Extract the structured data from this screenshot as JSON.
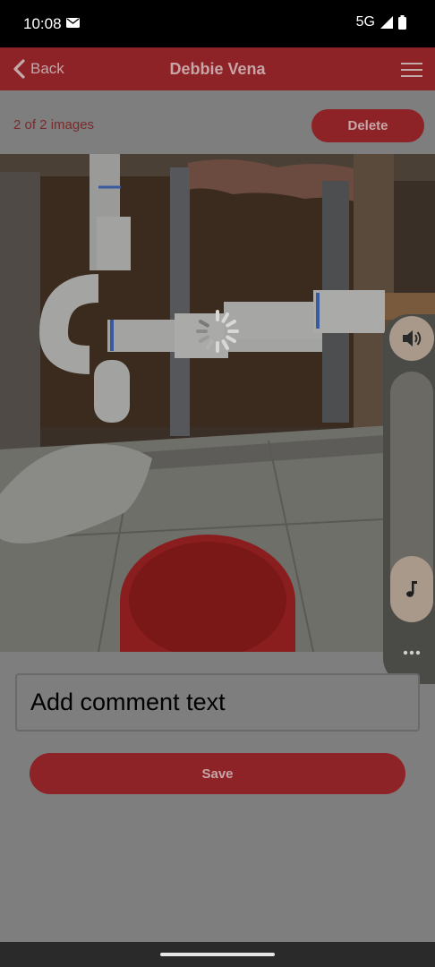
{
  "status_bar": {
    "time": "10:08",
    "network": "5G",
    "icons": [
      "mail-icon",
      "signal-icon",
      "battery-icon"
    ]
  },
  "app_bar": {
    "back_label": "Back",
    "title": "Debbie Vena",
    "menu_icon": "menu-icon"
  },
  "gallery": {
    "count_text": "2 of 2 images",
    "delete_label": "Delete"
  },
  "photo": {
    "description_icon": "loading-spinner-icon"
  },
  "side_controls": {
    "volume_icon": "volume-icon",
    "music_icon": "music-note-icon",
    "more_icon": "more-icon"
  },
  "comment": {
    "placeholder": "Add comment text",
    "value": ""
  },
  "save_label": "Save",
  "colors": {
    "brand": "#8e2327",
    "overlay": "#7e7e7e"
  }
}
